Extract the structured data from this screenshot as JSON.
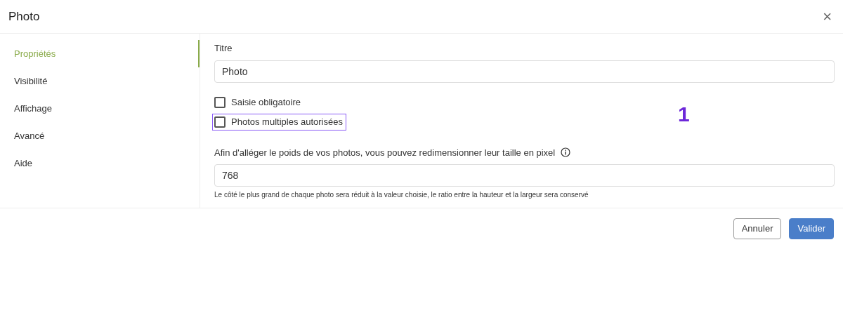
{
  "dialog": {
    "title": "Photo",
    "close": "×"
  },
  "sidebar": {
    "items": [
      {
        "label": "Propriétés",
        "selected": true
      },
      {
        "label": "Visibilité",
        "selected": false
      },
      {
        "label": "Affichage",
        "selected": false
      },
      {
        "label": "Avancé",
        "selected": false
      },
      {
        "label": "Aide",
        "selected": false
      }
    ]
  },
  "form": {
    "title_label": "Titre",
    "title_value": "Photo",
    "checkboxes": [
      {
        "label": "Saisie obligatoire",
        "checked": false,
        "highlighted": false
      },
      {
        "label": "Photos multiples autorisées",
        "checked": false,
        "highlighted": true
      }
    ],
    "annotation": "1",
    "size_label": "Afin d'alléger le poids de vos photos, vous pouvez redimensionner leur taille en pixel",
    "size_value": "768",
    "size_help": "Le côté le plus grand de chaque photo sera réduit à la valeur choisie, le ratio entre la hauteur et la largeur sera conservé"
  },
  "buttons": [
    {
      "label": "Annuler",
      "kind": "secondary"
    },
    {
      "label": "Valider",
      "kind": "primary"
    }
  ]
}
